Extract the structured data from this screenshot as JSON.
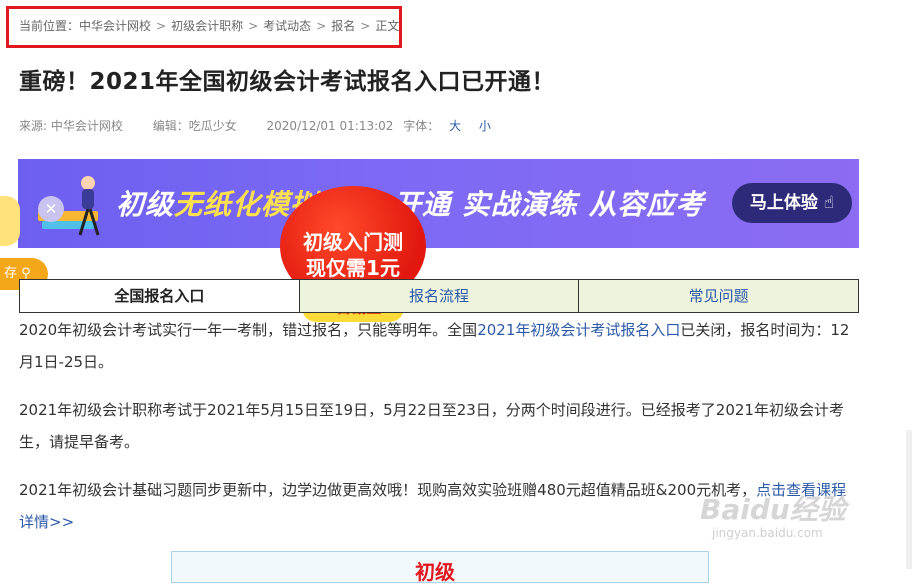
{
  "breadcrumb": {
    "prefix": "当前位置：",
    "items": [
      "中华会计网校",
      "初级会计职称",
      "考试动态",
      "报名",
      "正文"
    ],
    "separator": ">"
  },
  "article": {
    "title": "重磅！2021年全国初级会计考试报名入口已开通！",
    "source": "来源: 中华会计网校",
    "editor": "编辑：吃瓜少女",
    "date": "2020/12/01 01:13:02",
    "font_size_label": "字体：",
    "font_large": "大",
    "font_small": "小"
  },
  "banner": {
    "text_prefix": "初级",
    "text_highlight": "无纸化模拟",
    "text_suffix": "开通 实战演练 从容应考",
    "cta": "马上体验"
  },
  "promo": {
    "line1": "初级入门测",
    "line2": "现仅需1元",
    "deadline": "31日截止"
  },
  "float": {
    "tab_label": "存"
  },
  "tabs": [
    "全国报名入口",
    "报名流程",
    "常见问题"
  ],
  "paragraphs": {
    "p1_before": "2020年初级会计考试实行一年一考制，错过报名，只能等明年。全国",
    "p1_link": "2021年初级会计考试报名入口",
    "p1_after": "已关闭，报名时间为：12月1日-25日。",
    "p2": "2021年初级会计职称考试于2021年5月15日至19日，5月22日至23日，分两个时间段进行。已经报考了2021年初级会计考生，请提早备考。",
    "p3_before": "2021年初级会计基础习题同步更新中，边学边做更高效哦！现购高效实验班赠480元超值精品班&200元机考，",
    "p3_link": "点击查看课程详情>>"
  },
  "box_title": "初级",
  "watermark": {
    "big": "Baidu经验",
    "small": "jingyan.baidu.com"
  },
  "colors": {
    "breadcrumb_border": "#e0181e",
    "link": "#2b5aa8",
    "banner": "#7b69f5",
    "promo_red": "#e2180f"
  }
}
